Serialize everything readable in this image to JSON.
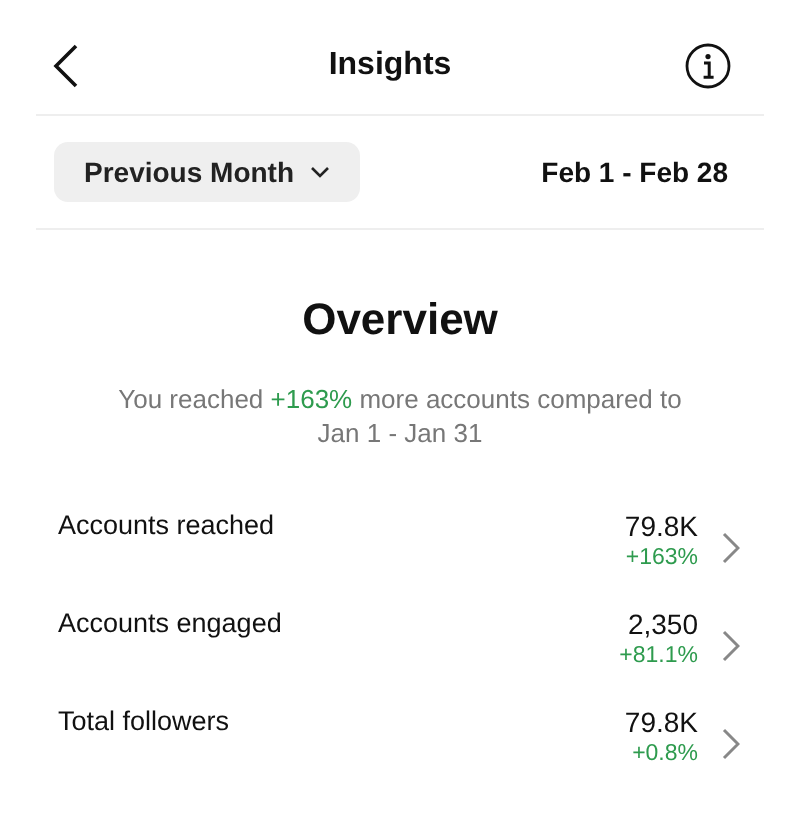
{
  "header": {
    "title": "Insights"
  },
  "filter": {
    "period": "Previous Month",
    "range": "Feb 1 - Feb 28"
  },
  "overview": {
    "title": "Overview",
    "summary_before": "You reached ",
    "summary_change": "+163%",
    "summary_after": " more accounts compared to",
    "summary_range": "Jan 1 - Jan 31"
  },
  "metrics": [
    {
      "label": "Accounts reached",
      "value": "79.8K",
      "change": "+163%"
    },
    {
      "label": "Accounts engaged",
      "value": "2,350",
      "change": "+81.1%"
    },
    {
      "label": "Total followers",
      "value": "79.8K",
      "change": "+0.8%"
    }
  ]
}
